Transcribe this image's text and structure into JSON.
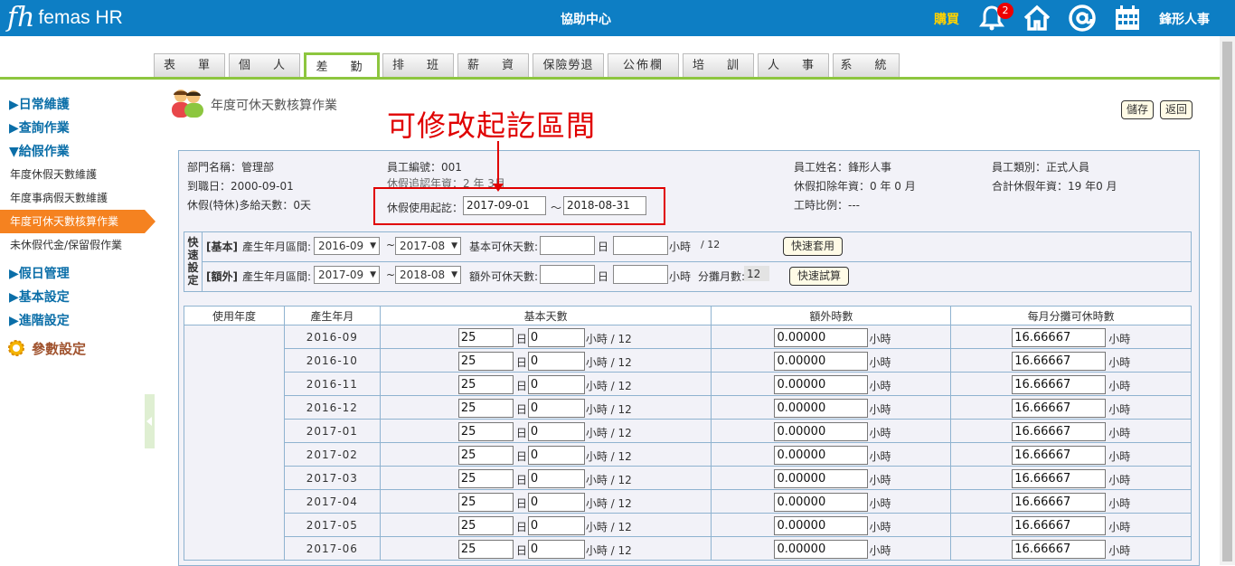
{
  "header": {
    "logo_mark": "fh",
    "logo_text": "femas HR",
    "help_center": "協助中心",
    "buy": "購買",
    "notification_count": "2",
    "username": "鋒形人事"
  },
  "tabs": [
    "表　單",
    "個　人",
    "差　勤",
    "排　班",
    "薪　資",
    "保險勞退",
    "公佈欄",
    "培　訓",
    "人　事",
    "系　統"
  ],
  "active_tab": "差　勤",
  "sidebar": {
    "daily": "▶日常維護",
    "query": "▶查詢作業",
    "leave": "▼給假作業",
    "items": [
      "年度休假天數維護",
      "年度事病假天數維護",
      "年度可休天數核算作業",
      "未休假代金/保留假作業"
    ],
    "holiday": "▶假日管理",
    "basic": "▶基本設定",
    "advanced": "▶進階設定",
    "params": "參數設定"
  },
  "page": {
    "title": "年度可休天數核算作業",
    "save": "儲存",
    "back": "返回",
    "annotation": "可修改起訖區間"
  },
  "info": {
    "dept": "部門名稱：管理部",
    "emp_no": "員工編號：001",
    "emp_name": "員工姓名：鋒形人事",
    "emp_type": "員工類別：正式人員",
    "join_date": "到職日：2000-09-01",
    "leave_seniority": "休假追認年資：2 年 3月",
    "deduct": "休假扣除年資：0 年 0 月",
    "total": "合計休假年資：19 年0 月",
    "special": "休假(特休)多給天數：0天",
    "period_label": "休假使用起訖：",
    "period_start": "2017-09-01",
    "period_sep": "～",
    "period_end": "2018-08-31",
    "ratio": "工時比例：---"
  },
  "quick": {
    "label": "快速設定",
    "basic_tag": "[基本]",
    "extra_tag": "[額外]",
    "range_label": "產生年月區間:",
    "basic_from": "2016-09",
    "basic_to": "2017-08",
    "extra_from": "2017-09",
    "extra_to": "2018-08",
    "tilde": "~",
    "basic_days_label": "基本可休天數:",
    "extra_days_label": "額外可休天數:",
    "day": "日",
    "hour": "小時",
    "per12": "/ 12",
    "share_label": "分攤月數:",
    "share_value": "12",
    "apply_btn": "快速套用",
    "trial_btn": "快速試算"
  },
  "table": {
    "headers": [
      "使用年度",
      "產生年月",
      "基本天數",
      "額外時數",
      "每月分攤可休時數"
    ],
    "day_unit": "日",
    "hour_unit": "小時 / 12",
    "hour": "小時",
    "rows": [
      {
        "ym": "2016-09",
        "days": "25",
        "hours": "0",
        "extra": "0.00000",
        "monthly": "16.66667"
      },
      {
        "ym": "2016-10",
        "days": "25",
        "hours": "0",
        "extra": "0.00000",
        "monthly": "16.66667"
      },
      {
        "ym": "2016-11",
        "days": "25",
        "hours": "0",
        "extra": "0.00000",
        "monthly": "16.66667"
      },
      {
        "ym": "2016-12",
        "days": "25",
        "hours": "0",
        "extra": "0.00000",
        "monthly": "16.66667"
      },
      {
        "ym": "2017-01",
        "days": "25",
        "hours": "0",
        "extra": "0.00000",
        "monthly": "16.66667"
      },
      {
        "ym": "2017-02",
        "days": "25",
        "hours": "0",
        "extra": "0.00000",
        "monthly": "16.66667"
      },
      {
        "ym": "2017-03",
        "days": "25",
        "hours": "0",
        "extra": "0.00000",
        "monthly": "16.66667"
      },
      {
        "ym": "2017-04",
        "days": "25",
        "hours": "0",
        "extra": "0.00000",
        "monthly": "16.66667"
      },
      {
        "ym": "2017-05",
        "days": "25",
        "hours": "0",
        "extra": "0.00000",
        "monthly": "16.66667"
      },
      {
        "ym": "2017-06",
        "days": "25",
        "hours": "0",
        "extra": "0.00000",
        "monthly": "16.66667"
      }
    ]
  }
}
